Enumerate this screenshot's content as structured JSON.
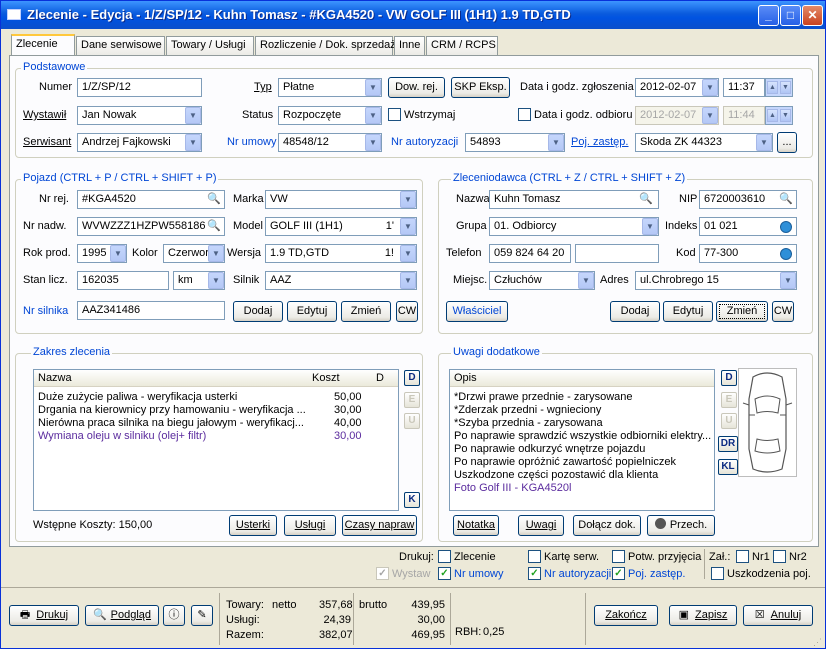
{
  "window": {
    "title": "Zlecenie - Edycja - 1/Z/SP/12 - Kuhn Tomasz - #KGA4520 - VW GOLF III (1H1) 1.9 TD,GTD"
  },
  "tabs": [
    "Zlecenie",
    "Dane serwisowe",
    "Towary / Usługi",
    "Rozliczenie / Dok. sprzedaży",
    "Inne",
    "CRM / RCPS"
  ],
  "basic": {
    "group": "Podstawowe",
    "numer_label": "Numer",
    "numer": "1/Z/SP/12",
    "typ_label": "Typ",
    "typ": "Płatne",
    "dow_rej": "Dow. rej.",
    "skp": "SKP Eksp.",
    "data_zgl_label": "Data i godz. zgłoszenia",
    "data_zgl": "2012-02-07",
    "godz_zgl": "11:37",
    "wystawil_label": "Wystawił",
    "wystawil": "Jan Nowak",
    "status_label": "Status",
    "status": "Rozpoczęte",
    "wstrzymaj": "Wstrzymaj",
    "data_odb_label": "Data i godz. odbioru",
    "data_odb": "2012-02-07",
    "godz_odb": "11:44",
    "serwisant_label": "Serwisant",
    "serwisant": "Andrzej Fajkowski",
    "nr_umowy_label": "Nr umowy",
    "nr_umowy": "48548/12",
    "nr_aut_label": "Nr autoryzacji",
    "nr_aut": "54893",
    "poj_label": "Poj. zastęp.",
    "poj": "Skoda ZK 44323",
    "ellipsis": "..."
  },
  "vehicle": {
    "group": "Pojazd (CTRL + P / CTRL + SHIFT + P)",
    "nrrej_label": "Nr rej.",
    "nrrej": "#KGA4520",
    "marka_label": "Marka",
    "marka": "VW",
    "nrnadw_label": "Nr nadw.",
    "nrnadw": "WVWZZZ1HZPW558186",
    "model_label": "Model",
    "model": "GOLF III (1H1)",
    "model_suffix": "1'",
    "rok_label": "Rok prod.",
    "rok": "1995",
    "kolor_label": "Kolor",
    "kolor": "Czerwor",
    "wersja_label": "Wersja",
    "wersja": "1.9 TD,GTD",
    "wersja_suffix": "1!",
    "stan_label": "Stan licz.",
    "stan": "162035",
    "km": "km",
    "silnik_label": "Silnik",
    "silnik": "AAZ",
    "nrsil_label": "Nr silnika",
    "nrsil": "AAZ341486",
    "dodaj": "Dodaj",
    "edytuj": "Edytuj",
    "zmien": "Zmień",
    "cw": "CW"
  },
  "client": {
    "group": "Zleceniodawca (CTRL + Z / CTRL + SHIFT + Z)",
    "nazwa_label": "Nazwa",
    "nazwa": "Kuhn Tomasz",
    "nip_label": "NIP",
    "nip": "6720003610",
    "grupa_label": "Grupa",
    "grupa": "01. Odbiorcy",
    "indeks_label": "Indeks",
    "indeks": "01 021",
    "tel_label": "Telefon",
    "tel": "059 824 64 20",
    "kod_label": "Kod",
    "kod": "77-300",
    "miejsc_label": "Miejsc.",
    "miejsc": "Człuchów",
    "adres_label": "Adres",
    "adres": "ul.Chrobrego 15",
    "wlasciciel": "Właściciel",
    "dodaj": "Dodaj",
    "edytuj": "Edytuj",
    "zmien": "Zmień",
    "cw": "CW"
  },
  "scope": {
    "group": "Zakres zlecenia",
    "col_nazwa": "Nazwa",
    "col_koszt": "Koszt",
    "col_d": "D",
    "rows": [
      {
        "n": "Duże zużycie paliwa - weryfikacja usterki",
        "k": "50,00"
      },
      {
        "n": "Drgania na kierownicy przy hamowaniu - weryfikacja ...",
        "k": "30,00"
      },
      {
        "n": "Nierówna praca silnika na biegu jałowym - weryfikacj...",
        "k": "40,00"
      },
      {
        "n": "Wymiana oleju w silniku (olej+ filtr)",
        "k": "30,00"
      }
    ],
    "side": [
      "D",
      "E",
      "U",
      "K"
    ],
    "koszty": "Wstępne Koszty: 150,00",
    "usterki": "Usterki",
    "uslugi": "Usługi",
    "czasy": "Czasy napraw"
  },
  "notes": {
    "group": "Uwagi dodatkowe",
    "col": "Opis",
    "rows": [
      "*Drzwi prawe przednie - zarysowane",
      "*Zderzak przedni - wgnieciony",
      "*Szyba przednia - zarysowana",
      "Po naprawie sprawdzić wszystkie odbiorniki elektry...",
      "Po naprawie odkurzyć wnętrze pojazdu",
      "Po naprawie opróżnić zawartość popielniczek",
      "Uszkodzone części pozostawić dla klienta",
      "Foto Golf III - KGA4520l"
    ],
    "side": [
      "D",
      "E",
      "U",
      "DR",
      "KL"
    ],
    "notatka": "Notatka",
    "uwagi": "Uwagi",
    "dolacz": "Dołącz dok.",
    "przech": "Przech."
  },
  "print": {
    "drukuj": "Drukuj:",
    "zlecenie": "Zlecenie",
    "wystaw": "Wystaw",
    "nr_umowy": "Nr umowy",
    "karte": "Kartę serw.",
    "nr_aut": "Nr autoryzacji",
    "potw": "Potw. przyjęcia",
    "poj": "Poj. zastęp.",
    "zal": "Zał.:",
    "nr1": "Nr1",
    "nr2": "Nr2",
    "uszk": "Uszkodzenia poj."
  },
  "footer": {
    "drukuj": "Drukuj",
    "podglad": "Podgląd",
    "towary": "Towary:",
    "netto": "netto",
    "brutto": "brutto",
    "towary_netto": "357,68",
    "towary_brutto": "439,95",
    "uslugi": "Usługi:",
    "uslugi_netto": "24,39",
    "uslugi_brutto": "30,00",
    "razem": "Razem:",
    "razem_netto": "382,07",
    "razem_brutto": "469,95",
    "rbh": "RBH:",
    "rbh_val": "0,25",
    "zakoncz": "Zakończ",
    "zapisz": "Zapisz",
    "anuluj": "Anuluj"
  },
  "colors": {
    "titlebar": "#0A5BDD",
    "accent_blue": "#0046D5",
    "purple": "#5B2C9E"
  }
}
